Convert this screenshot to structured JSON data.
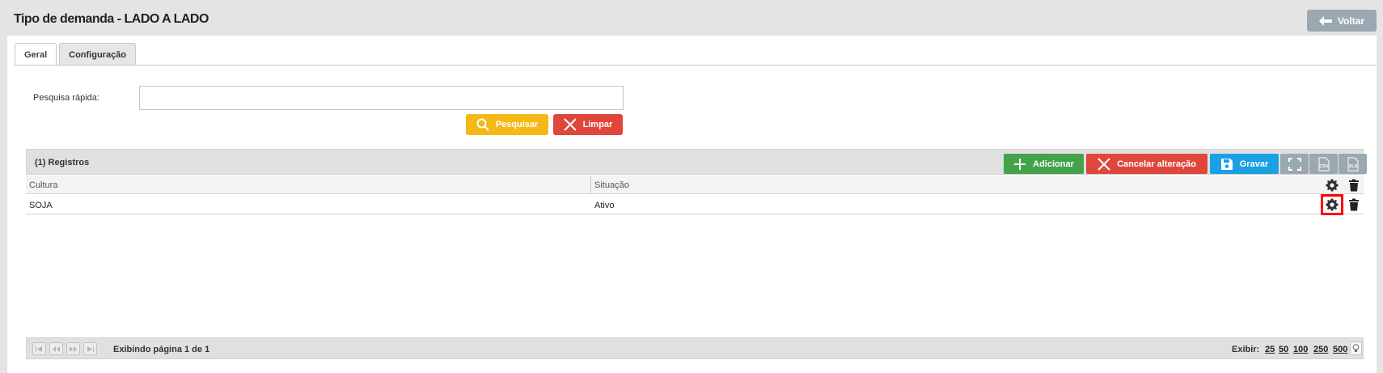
{
  "header": {
    "title": "Tipo de demanda - LADO A LADO",
    "back_label": "Voltar"
  },
  "tabs": [
    {
      "label": "Geral"
    },
    {
      "label": "Configuração"
    }
  ],
  "search": {
    "label": "Pesquisa rápida:",
    "value": "",
    "placeholder": "",
    "search_label": "Pesquisar",
    "clear_label": "Limpar"
  },
  "grid": {
    "records_label": "(1) Registros",
    "toolbar": {
      "add_label": "Adicionar",
      "cancel_label": "Cancelar alteração",
      "save_label": "Gravar",
      "csv_label": "CSV",
      "xls_label": "XLS"
    },
    "columns": [
      "Cultura",
      "Situação"
    ],
    "rows": [
      {
        "cultura": "SOJA",
        "situacao": "Ativo"
      }
    ]
  },
  "pager": {
    "status": "Exibindo página 1 de 1",
    "show_label": "Exibir:",
    "page_sizes": [
      "25",
      "50",
      "100",
      "250",
      "500"
    ]
  },
  "colors": {
    "add": "#43a34a",
    "cancel": "#e0473c",
    "save": "#1aa0e5",
    "search": "#f5b817",
    "gray_button": "#9aa8b1",
    "highlight": "#ff0000"
  },
  "icons": [
    "arrow-left-icon",
    "search-icon",
    "close-icon",
    "plus-icon",
    "floppy-icon",
    "fullscreen-icon",
    "csv-file-icon",
    "xls-file-icon",
    "gear-icon",
    "trash-icon",
    "first-page-icon",
    "prev-page-icon",
    "next-page-icon",
    "last-page-icon",
    "lightbulb-icon"
  ]
}
